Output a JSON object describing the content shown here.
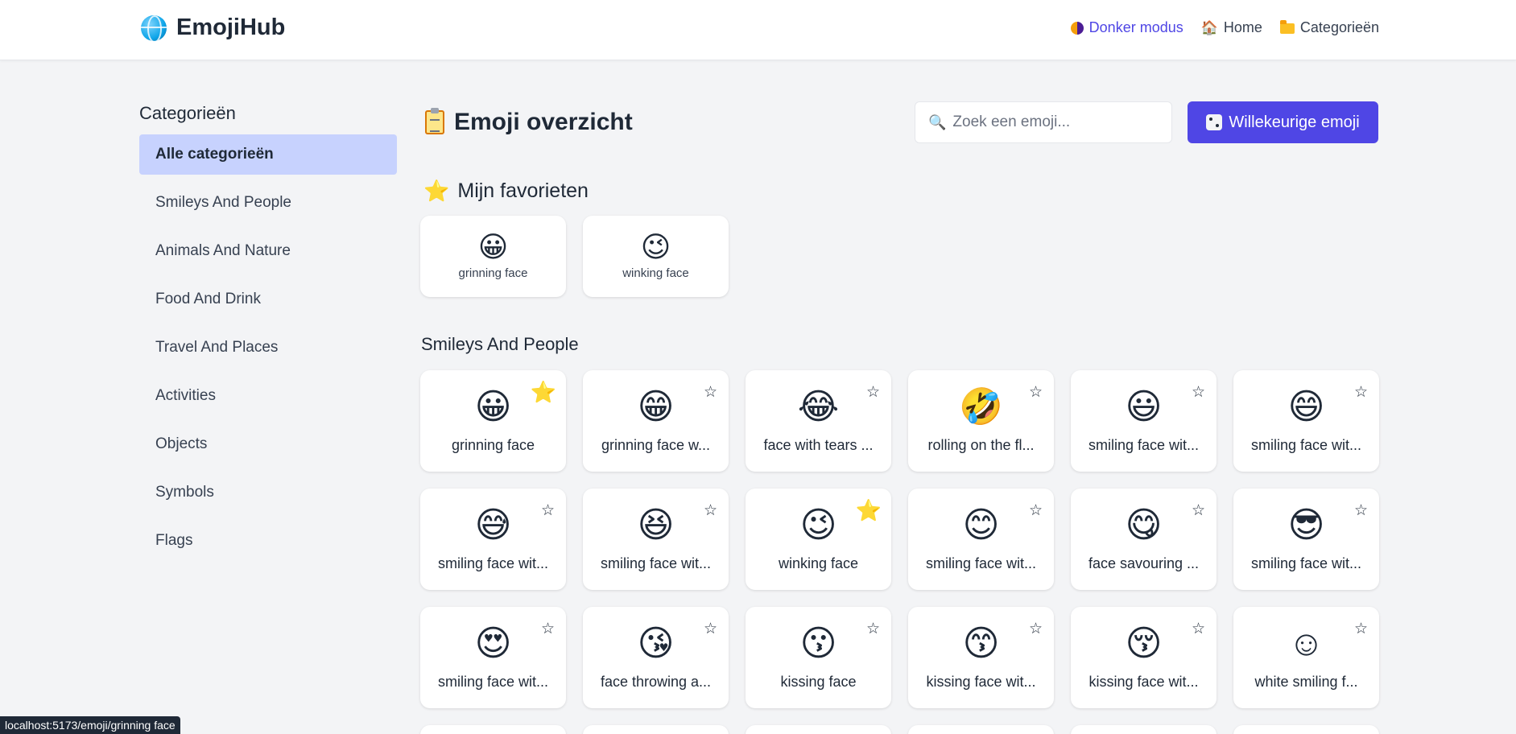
{
  "app": {
    "title": "EmojiHub"
  },
  "nav": {
    "dark_mode": "Donker modus",
    "home": "Home",
    "categories": "Categorieën"
  },
  "sidebar": {
    "heading": "Categorieën",
    "items": [
      {
        "label": "Alle categorieën",
        "active": true
      },
      {
        "label": "Smileys And People"
      },
      {
        "label": "Animals And Nature"
      },
      {
        "label": "Food And Drink"
      },
      {
        "label": "Travel And Places"
      },
      {
        "label": "Activities"
      },
      {
        "label": "Objects"
      },
      {
        "label": "Symbols"
      },
      {
        "label": "Flags"
      }
    ]
  },
  "main": {
    "title": "Emoji overzicht",
    "search_placeholder": "Zoek een emoji...",
    "random_button": "Willekeurige emoji",
    "favorites_title": "Mijn favorieten",
    "favorites": [
      {
        "emoji": "😀",
        "name": "grinning face"
      },
      {
        "emoji": "😉",
        "name": "winking face"
      }
    ],
    "section_title": "Smileys And People",
    "emojis": [
      {
        "emoji": "😀",
        "name": "grinning face",
        "fav": true
      },
      {
        "emoji": "😁",
        "name": "grinning face w...",
        "fav": false
      },
      {
        "emoji": "😂",
        "name": "face with tears ...",
        "fav": false
      },
      {
        "emoji": "🤣",
        "name": "rolling on the fl...",
        "fav": false
      },
      {
        "emoji": "😃",
        "name": "smiling face wit...",
        "fav": false
      },
      {
        "emoji": "😄",
        "name": "smiling face wit...",
        "fav": false
      },
      {
        "emoji": "😅",
        "name": "smiling face wit...",
        "fav": false
      },
      {
        "emoji": "😆",
        "name": "smiling face wit...",
        "fav": false
      },
      {
        "emoji": "😉",
        "name": "winking face",
        "fav": true
      },
      {
        "emoji": "😊",
        "name": "smiling face wit...",
        "fav": false
      },
      {
        "emoji": "😋",
        "name": "face savouring ...",
        "fav": false
      },
      {
        "emoji": "😎",
        "name": "smiling face wit...",
        "fav": false
      },
      {
        "emoji": "😍",
        "name": "smiling face wit...",
        "fav": false
      },
      {
        "emoji": "😘",
        "name": "face throwing a...",
        "fav": false
      },
      {
        "emoji": "😗",
        "name": "kissing face",
        "fav": false
      },
      {
        "emoji": "😙",
        "name": "kissing face wit...",
        "fav": false
      },
      {
        "emoji": "😚",
        "name": "kissing face wit...",
        "fav": false
      },
      {
        "emoji": "☺",
        "name": "white smiling f...",
        "fav": false
      }
    ]
  },
  "status": {
    "url": "localhost:5173/emoji/grinning face"
  },
  "colors": {
    "accent": "#4f46e5",
    "active_category": "#c7d2fe",
    "star_on": "#fbbf24"
  }
}
